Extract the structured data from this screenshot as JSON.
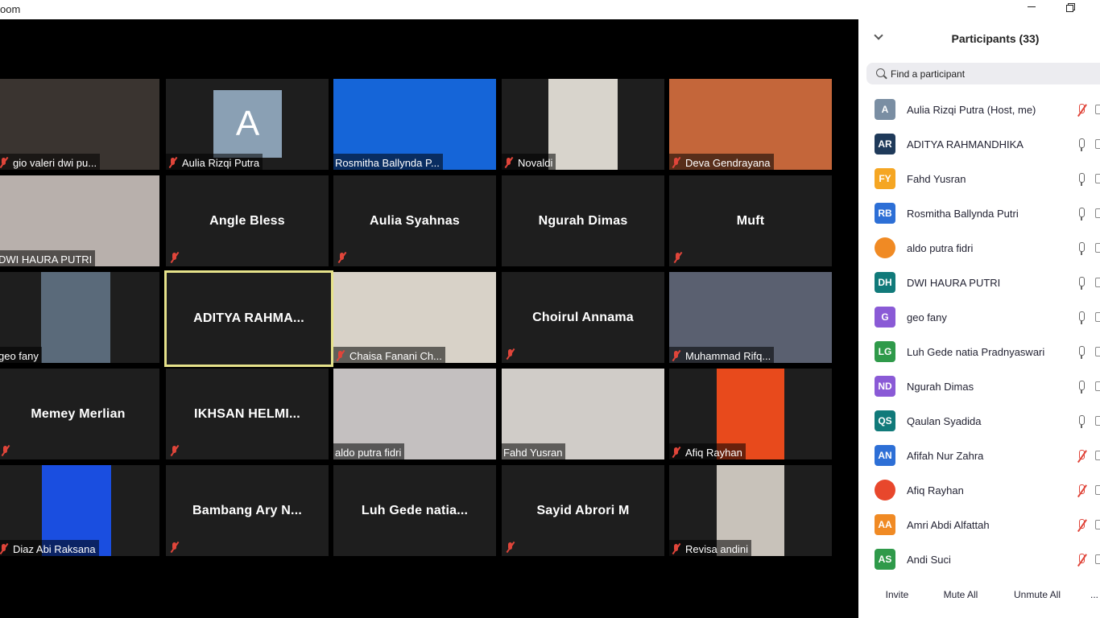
{
  "window": {
    "title": "oom"
  },
  "tiles": [
    {
      "name": "gio valeri dwi pu...",
      "type": "video",
      "muted": true
    },
    {
      "name": "Aulia Rizqi Putra",
      "type": "avatar",
      "letter": "A",
      "muted": true
    },
    {
      "name": "Rosmitha Ballynda P...",
      "type": "video",
      "muted": false
    },
    {
      "name": "Novaldi",
      "type": "video",
      "muted": true
    },
    {
      "name": "Deva Gendrayana",
      "type": "video",
      "muted": true
    },
    {
      "name": "DWI HAURA PUTRI",
      "type": "video",
      "muted": false
    },
    {
      "name": "Angle Bless",
      "type": "name",
      "muted": true
    },
    {
      "name": "Aulia Syahnas",
      "type": "name",
      "muted": true
    },
    {
      "name": "Ngurah Dimas",
      "type": "name",
      "muted": false
    },
    {
      "name": "Muft",
      "type": "name",
      "muted": true
    },
    {
      "name": "geo fany",
      "type": "video",
      "muted": false
    },
    {
      "name": "ADITYA RAHMA...",
      "type": "name",
      "muted": false,
      "active": true
    },
    {
      "name": "Chaisa Fanani Ch...",
      "type": "video",
      "muted": true
    },
    {
      "name": "Choirul Annama",
      "type": "name",
      "muted": true
    },
    {
      "name": "Muhammad Rifq...",
      "type": "video",
      "muted": true
    },
    {
      "name": "Memey Merlian",
      "type": "name",
      "muted": true
    },
    {
      "name": "IKHSAN HELMI...",
      "type": "name",
      "muted": true
    },
    {
      "name": "aldo putra fidri",
      "type": "video",
      "muted": false
    },
    {
      "name": "Fahd Yusran",
      "type": "video",
      "muted": false
    },
    {
      "name": "Afiq Rayhan",
      "type": "video",
      "muted": true
    },
    {
      "name": "Diaz Abi Raksana",
      "type": "video",
      "muted": true
    },
    {
      "name": "Bambang Ary N...",
      "type": "name",
      "muted": true
    },
    {
      "name": "Luh Gede natia...",
      "type": "name",
      "muted": false
    },
    {
      "name": "Sayid Abrori M",
      "type": "name",
      "muted": true
    },
    {
      "name": "Revisa andini",
      "type": "video",
      "muted": true
    }
  ],
  "panel": {
    "title": "Participants (33)",
    "search_placeholder": "Find a participant",
    "participants": [
      {
        "name": "Aulia Rizqi Putra (Host, me)",
        "initials": "A",
        "color": "#7a8ea3",
        "muted": true
      },
      {
        "name": "ADITYA RAHMANDHIKA",
        "initials": "AR",
        "color": "#1f3a5a",
        "muted": false
      },
      {
        "name": "Fahd Yusran",
        "initials": "FY",
        "color": "#f5a623",
        "muted": false
      },
      {
        "name": "Rosmitha Ballynda Putri",
        "initials": "RB",
        "color": "#2d6fd6",
        "muted": false
      },
      {
        "name": "aldo putra fidri",
        "initials": "",
        "color": "#f08a24",
        "muted": false
      },
      {
        "name": "DWI HAURA PUTRI",
        "initials": "DH",
        "color": "#117a7a",
        "muted": false
      },
      {
        "name": "geo fany",
        "initials": "G",
        "color": "#8a5ad6",
        "muted": false
      },
      {
        "name": "Luh Gede natia Pradnyaswari",
        "initials": "LG",
        "color": "#2f9a4a",
        "muted": false
      },
      {
        "name": "Ngurah Dimas",
        "initials": "ND",
        "color": "#8a5ad6",
        "muted": false
      },
      {
        "name": "Qaulan Syadida",
        "initials": "QS",
        "color": "#117a7a",
        "muted": false
      },
      {
        "name": "Afifah Nur Zahra",
        "initials": "AN",
        "color": "#2d6fd6",
        "muted": true
      },
      {
        "name": "Afiq Rayhan",
        "initials": "",
        "color": "#e8472c",
        "muted": true
      },
      {
        "name": "Amri Abdi Alfattah",
        "initials": "AA",
        "color": "#f08a24",
        "muted": true
      },
      {
        "name": "Andi Suci",
        "initials": "AS",
        "color": "#2f9a4a",
        "muted": true
      }
    ],
    "footer": {
      "invite": "Invite",
      "mute_all": "Mute All",
      "unmute_all": "Unmute All",
      "more": "..."
    }
  }
}
